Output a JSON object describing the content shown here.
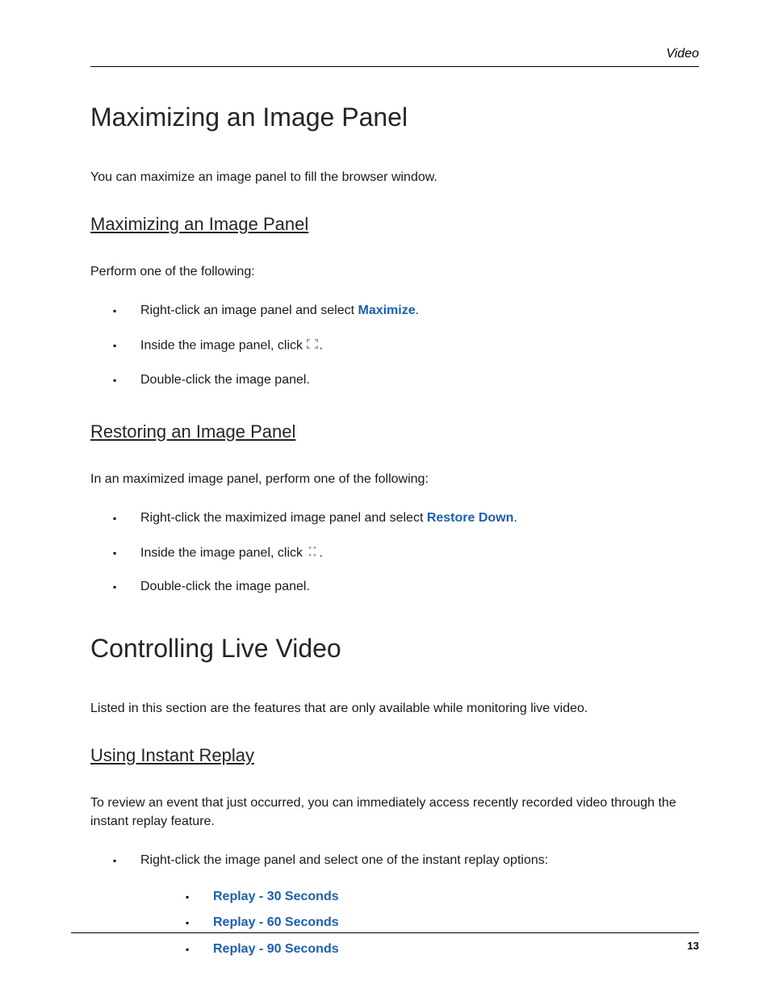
{
  "header": {
    "section": "Video"
  },
  "footer": {
    "page": "13"
  },
  "h1_a": "Maximizing an Image Panel",
  "p_a": "You can maximize an image panel to fill the browser window.",
  "sec_max": {
    "h2": "Maximizing an Image Panel",
    "intro": "Perform one of the following:",
    "li1_pre": "Right-click an image panel and select ",
    "li1_bold": "Maximize",
    "li1_post": ".",
    "li2_pre": "Inside the image panel, click ",
    "li2_post": ".",
    "li3": "Double-click the image panel."
  },
  "sec_rest": {
    "h2": "Restoring an Image Panel",
    "intro": "In an maximized image panel, perform one of the following:",
    "li1_pre": "Right-click the maximized image panel and select ",
    "li1_bold": "Restore Down",
    "li1_post": ".",
    "li2_pre": "Inside the image panel, click ",
    "li2_post": ".",
    "li3": "Double-click the image panel."
  },
  "h1_b": "Controlling Live Video",
  "p_b": "Listed in this section are the features that are only available while monitoring live video.",
  "sec_replay": {
    "h2": "Using Instant Replay",
    "intro": "To review an event that just occurred, you can immediately access recently recorded video through the instant replay feature.",
    "li1": "Right-click the image panel and select one of the instant replay options:",
    "opts": {
      "o1": "Replay - 30 Seconds",
      "o2": "Replay - 60 Seconds",
      "o3": "Replay - 90 Seconds"
    }
  }
}
